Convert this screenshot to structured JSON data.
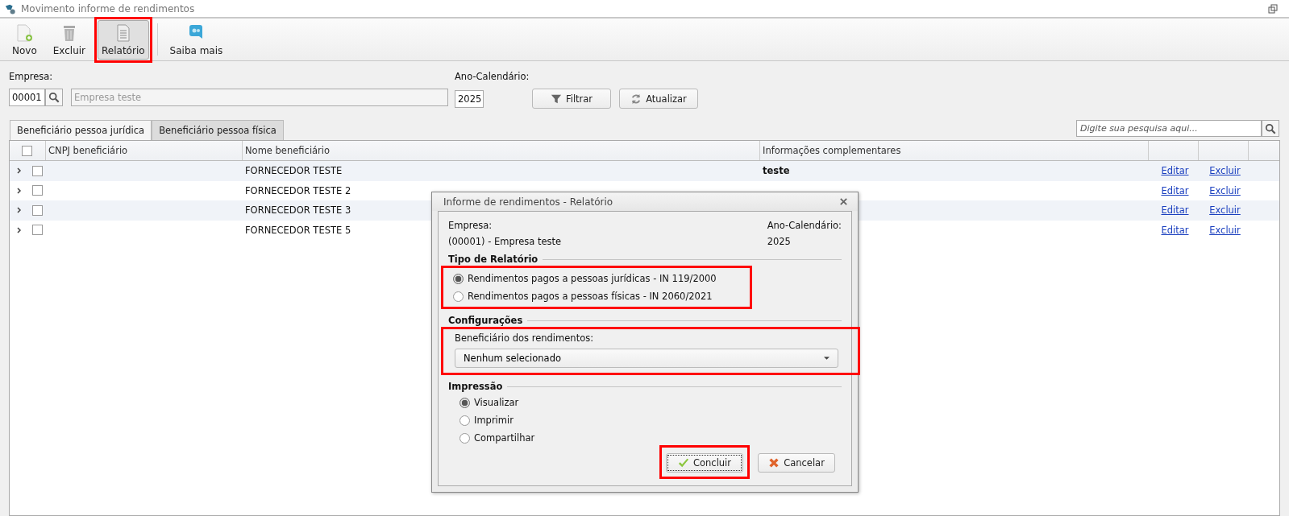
{
  "window": {
    "title": "Movimento informe de rendimentos"
  },
  "toolbar": [
    {
      "kind": "new",
      "label": "Novo",
      "selected": false
    },
    {
      "kind": "delete",
      "label": "Excluir",
      "selected": false
    },
    {
      "kind": "report",
      "label": "Relatório",
      "highlighted": true,
      "selected": true
    },
    {
      "kind": "info",
      "label": "Saiba mais",
      "selected": false
    }
  ],
  "filters": {
    "empresa_label": "Empresa:",
    "empresa_code": "00001",
    "empresa_name_placeholder": "Empresa teste",
    "ano_label": "Ano-Calendário:",
    "ano_value": "2025",
    "buttons": [
      {
        "kind": "filter",
        "label": "Filtrar"
      },
      {
        "kind": "refresh",
        "label": "Atualizar"
      }
    ]
  },
  "tabs": [
    {
      "label": "Beneficiário pessoa jurídica",
      "selected": true
    },
    {
      "label": "Beneficiário pessoa física",
      "selected": false
    }
  ],
  "search": {
    "placeholder": "Digite sua pesquisa aqui..."
  },
  "table": {
    "all_checked": false,
    "columns": [
      "CNPJ beneficiário",
      "Nome beneficiário",
      "Informações complementares"
    ],
    "rows": [
      {
        "name": "FORNECEDOR TESTE",
        "info": "teste",
        "edit": "Editar",
        "delete": "Excluir",
        "checked": false
      },
      {
        "name": "FORNECEDOR TESTE 2",
        "edit": "Editar",
        "delete": "Excluir",
        "checked": false
      },
      {
        "name": "FORNECEDOR TESTE 3",
        "edit": "Editar",
        "delete": "Excluir",
        "checked": false
      },
      {
        "name": "FORNECEDOR TESTE 5",
        "edit": "Editar",
        "delete": "Excluir",
        "checked": false
      }
    ]
  },
  "dialog": {
    "title": "Informe de rendimentos - Relatório",
    "empresa_label": "Empresa:",
    "empresa_value": "(00001) - Empresa teste",
    "ano_label": "Ano-Calendário:",
    "ano_value": "2025",
    "sections": [
      {
        "kind": "radios",
        "title": "Tipo de Relatório",
        "highlighted": true,
        "options": [
          {
            "label": "Rendimentos pagos a pessoas jurídicas - IN 119/2000",
            "selected": true
          },
          {
            "label": "Rendimentos pagos a pessoas físicas - IN 2060/2021",
            "selected": false
          }
        ]
      },
      {
        "kind": "select",
        "title": "Configurações",
        "highlighted": true,
        "field_label": "Beneficiário dos rendimentos:",
        "value": "Nenhum selecionado"
      },
      {
        "kind": "radios",
        "title": "Impressão",
        "highlighted": false,
        "options": [
          {
            "label": "Visualizar",
            "selected": true
          },
          {
            "label": "Imprimir",
            "selected": false
          },
          {
            "label": "Compartilhar",
            "selected": false
          }
        ]
      }
    ],
    "buttons": [
      {
        "kind": "ok",
        "label": "Concluir",
        "highlighted": true
      },
      {
        "kind": "cancel",
        "label": "Cancelar",
        "highlighted": false
      }
    ]
  }
}
